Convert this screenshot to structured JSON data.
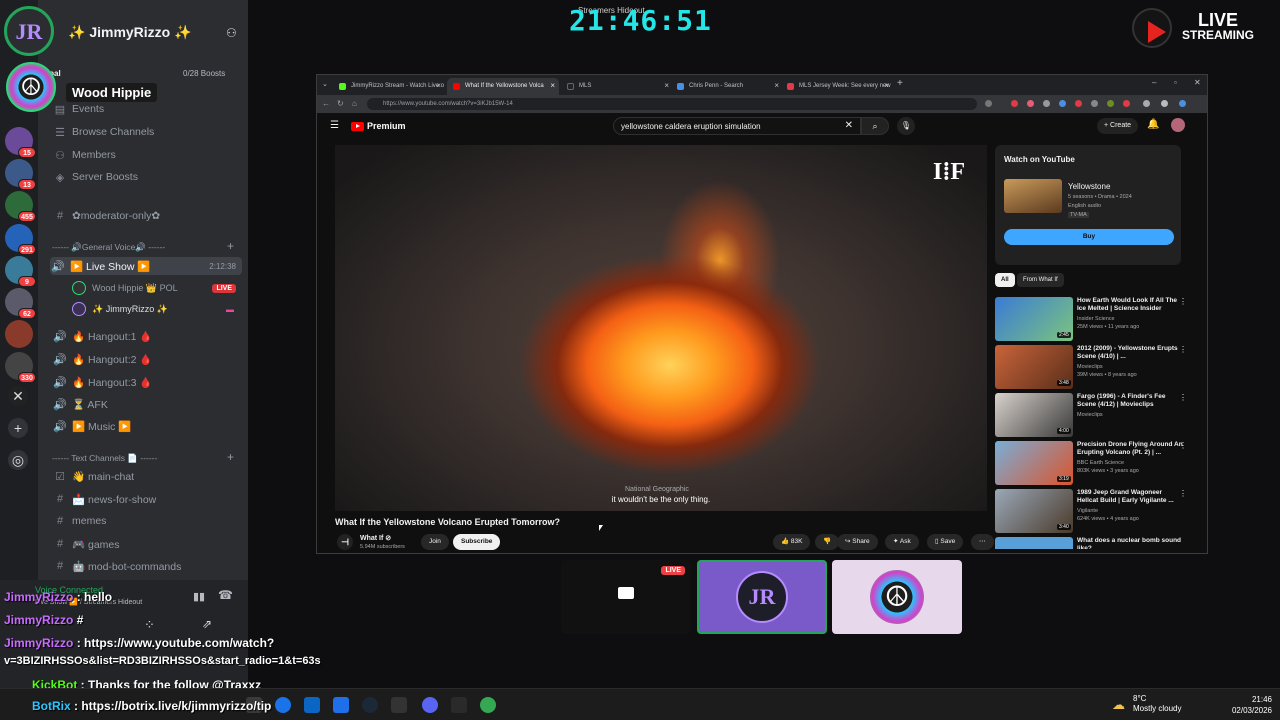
{
  "overlay": {
    "clock": "21:46:51",
    "clock_caption": "Streamers Hideout",
    "live_logo_line1": "LIVE",
    "live_logo_line2": "STREAMING",
    "host_name": "Wood Hippie"
  },
  "server_rail": {
    "badges": [
      "15",
      "13",
      "455",
      "291",
      "9",
      "62",
      "330"
    ]
  },
  "channel_sidebar": {
    "guild_name": "✨ JimmyRizzo ✨",
    "boost_goal_label": "Boost Goal",
    "boost_count": "0/28 Boosts",
    "nav": [
      "Events",
      "Browse Channels",
      "Members",
      "Server Boosts"
    ],
    "moderator_channel": "✿moderator-only✿",
    "voice_category": "------ 🔊General Voice🔊 ------",
    "live_show": {
      "name": "▶️ Live Show ▶️",
      "time": "2:12:38"
    },
    "members": [
      {
        "name": "Wood Hippie  👑 POL",
        "status": "LIVE"
      },
      {
        "name": "✨ JimmyRizzo ✨",
        "status": ""
      }
    ],
    "voice_channels": [
      "🔥 Hangout:1 🩸",
      "🔥 Hangout:2 🩸",
      "🔥 Hangout:3 🩸",
      "⏳ AFK",
      "▶️ Music ▶️"
    ],
    "text_category": "------ Text Channels 📄 ------",
    "text_channels": [
      "👋 main-chat",
      "📩 news-for-show",
      "memes",
      "🎮 games",
      "🤖 mod-bot-commands"
    ],
    "voice_connected": "Voice Connected",
    "voice_location": "Live Show ▶️ / Streamers Hideout"
  },
  "browser": {
    "tabs": [
      {
        "title": "JimmyRizzo Stream - Watch Live o",
        "color": "#53fc18"
      },
      {
        "title": "What If the Yellowstone Volca",
        "color": "#ff0000"
      },
      {
        "title": "MLS",
        "color": "#222222"
      },
      {
        "title": "Chris Penn - Search",
        "color": "#4a90e2"
      },
      {
        "title": "MLS Jersey Week: See every new",
        "color": "#e63946"
      }
    ],
    "url": "https://www.youtube.com/watch?v=3iKJb15W-14"
  },
  "youtube": {
    "logo": "Premium",
    "search_query": "yellowstone caldera eruption simulation",
    "create_label": "Create",
    "video": {
      "title": "What If the Yellowstone Volcano Erupted Tomorrow?",
      "caption": "it wouldn't be the only thing.",
      "caption_source": "National Geographic",
      "channel": "What If ⊘",
      "subscribers": "5.94M subscribers",
      "join": "Join",
      "subscribe": "Subscribe",
      "likes": "83K",
      "share": "Share",
      "ask": "Ask",
      "save": "Save"
    },
    "watch_on_youtube": {
      "heading": "Watch on YouTube",
      "title": "Yellowstone",
      "meta1": "5 seasons • Drama • 2024",
      "meta2": "English audio",
      "rating": "TV-MA",
      "buy": "Buy"
    },
    "filter_chips": [
      "All",
      "From What If"
    ],
    "recommendations": [
      {
        "title": "How Earth Would Look If All The Ice Melted | Science Insider",
        "channel": "Insider Science",
        "views": "25M views • 11 years ago",
        "duration": "2:45",
        "color": "#3a7bd5"
      },
      {
        "title": "2012 (2009) - Yellowstone Erupts Scene (4/10) | ...",
        "channel": "Movieclips",
        "views": "39M views • 8 years ago",
        "duration": "3:48",
        "color": "#8a4b2a"
      },
      {
        "title": "Fargo (1996) - A Finder's Fee Scene (4/12) | Movieclips",
        "channel": "Movieclips",
        "views": "",
        "duration": "4:00",
        "color": "#c7c2bc"
      },
      {
        "title": "Precision Drone Flying Around An Erupting Volcano (Pt. 2) | ...",
        "channel": "BBC Earth Science",
        "views": "803K views • 3 years ago",
        "duration": "3:19",
        "color": "#d9542c"
      },
      {
        "title": "1989 Jeep Grand Wagoneer Hellcat Build | Early Vigilante ...",
        "channel": "Vigilante",
        "views": "624K views • 4 years ago",
        "duration": "3:40",
        "color": "#6b7a8a"
      },
      {
        "title": "What does a nuclear bomb sound like?",
        "channel": "",
        "views": "",
        "duration": "",
        "color": "#5aa0d8"
      }
    ]
  },
  "stream_tiles": {
    "live_badge": "LIVE"
  },
  "chat": [
    {
      "user": "JimmyRizzo",
      "text": " : hello",
      "cls": "u"
    },
    {
      "user": "JimmyRizzo",
      "text": " #",
      "cls": "u"
    },
    {
      "user": "JimmyRizzo",
      "text": " : https://www.youtube.com/watch?",
      "cls": "u"
    },
    {
      "user": "",
      "text": "v=3BIZIRHSSOs&list=RD3BIZIRHSSOs&start_radio=1&t=63s",
      "cls": "u"
    },
    {
      "user": "KickBot",
      "text": " : Thanks for the follow @Traxxz",
      "cls": "k"
    },
    {
      "user": "BotRix",
      "text": " : https://botrix.live/k/jimmyrizzo/tip",
      "cls": "b"
    }
  ],
  "taskbar": {
    "temperature": "8°C",
    "weather": "Mostly cloudy",
    "time": "21:46",
    "date": "02/03/2026"
  }
}
